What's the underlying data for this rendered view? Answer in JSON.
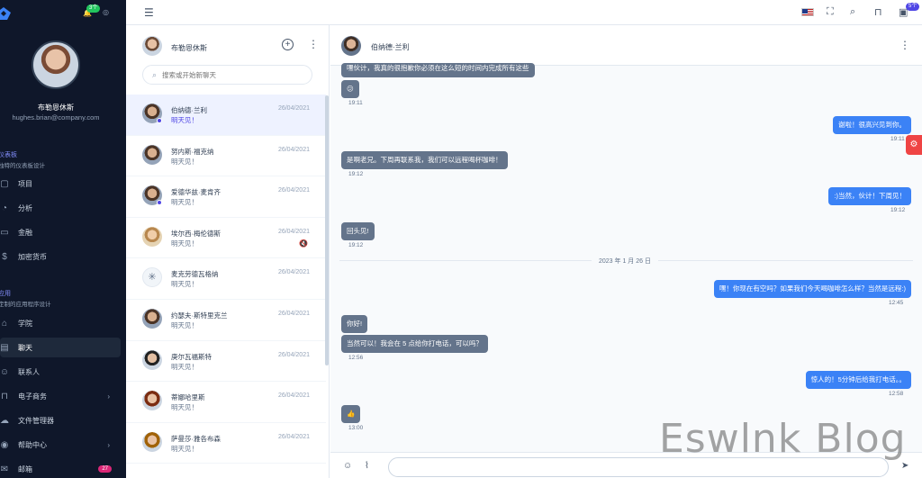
{
  "sidebar": {
    "user": {
      "name": "布勒恩休斯",
      "email": "hughes.brian@company.com"
    },
    "notification_badge": "3个",
    "sections": [
      {
        "title": "仪表板",
        "subtitle": "独特的仪表板设计"
      },
      {
        "title": "应用",
        "subtitle": "定制的应用程序设计"
      }
    ],
    "items": [
      {
        "label": "项目",
        "icon": "clipboard-icon"
      },
      {
        "label": "分析",
        "icon": "chart-pie-icon"
      },
      {
        "label": "金融",
        "icon": "cash-icon"
      },
      {
        "label": "加密货币",
        "icon": "currency-icon"
      },
      {
        "label": "学院",
        "icon": "academic-cap-icon"
      },
      {
        "label": "聊天",
        "icon": "chat-icon"
      },
      {
        "label": "联系人",
        "icon": "user-group-icon"
      },
      {
        "label": "电子商务",
        "icon": "shopping-cart-icon"
      },
      {
        "label": "文件管理器",
        "icon": "cloud-icon"
      },
      {
        "label": "帮助中心",
        "icon": "help-icon"
      },
      {
        "label": "邮箱",
        "icon": "mail-icon",
        "badge": "27"
      }
    ]
  },
  "topbar": {
    "inbox_badge": "5个"
  },
  "chat_list": {
    "me": "布勒恩休斯",
    "search_placeholder": "搜索或开始新聊天",
    "contacts": [
      {
        "name": "伯纳德·兰利",
        "date": "26/04/2021",
        "message": "明天见！",
        "online": true,
        "selected": true
      },
      {
        "name": "努内斯·福克纳",
        "date": "26/04/2021",
        "message": "明天见！"
      },
      {
        "name": "爱德华兹·麦肯齐",
        "date": "26/04/2021",
        "message": "明天见！",
        "online": true
      },
      {
        "name": "埃尔西·梅伦德斯",
        "date": "26/04/2021",
        "message": "明天见！",
        "muted": true
      },
      {
        "name": "麦克劳德瓦格纳",
        "date": "26/04/2021",
        "message": "明天见！"
      },
      {
        "name": "约瑟夫·斯特里克兰",
        "date": "26/04/2021",
        "message": "明天见！"
      },
      {
        "name": "庚尔瓦福斯特",
        "date": "26/04/2021",
        "message": "明天见！"
      },
      {
        "name": "蒂娜哈里斯",
        "date": "26/04/2021",
        "message": "明天见！"
      },
      {
        "name": "萨曼莎·雅各布森",
        "date": "26/04/2021",
        "message": "明天见！"
      }
    ]
  },
  "conversation": {
    "contact_name": "伯纳德·兰利",
    "date_divider": "2023 年 1 月 26 日",
    "messages": [
      {
        "dir": "in",
        "text": "嘿伙计，我真的很抱歉你必须在这么短的时间内完成所有这些",
        "time": ""
      },
      {
        "dir": "in",
        "text": "😕",
        "time": "19:11"
      },
      {
        "dir": "out",
        "text": "谢啦！很高兴见到你。",
        "time": "19:11"
      },
      {
        "dir": "in",
        "text": "是啊老兄。下周再联系我，我们可以远程喝杯咖啡！",
        "time": "19:12"
      },
      {
        "dir": "out",
        "text": ":)当然，伙计！下周见！",
        "time": "19:12"
      },
      {
        "dir": "in",
        "text": "回头见!",
        "time": "19:12"
      },
      {
        "dir": "out",
        "text": "嘿！你现在有空吗？如果我们今天喝咖啡怎么样？当然是远程:)",
        "time": "12:45"
      },
      {
        "dir": "in",
        "text": "你好!",
        "time": ""
      },
      {
        "dir": "in",
        "text": "当然可以！我会在 5 点给你打电话，可以吗？",
        "time": "12:56"
      },
      {
        "dir": "out",
        "text": "惊人的！5分钟后给我打电话。。",
        "time": "12:58"
      },
      {
        "dir": "in",
        "text": "👍",
        "time": "13:00"
      }
    ]
  },
  "watermark": "Eswlnk Blog"
}
